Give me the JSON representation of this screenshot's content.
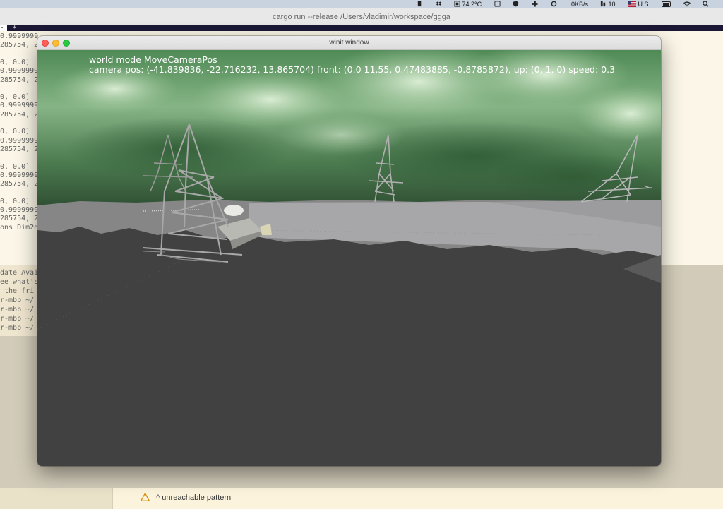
{
  "menubar": {
    "temperature": "74.2°C",
    "network": "0KB/s",
    "number": "10",
    "input_source": "U.S."
  },
  "terminal": {
    "title": "cargo run --release /Users/vladimir/workspace/ggga",
    "tab_label": "r",
    "tab_plus": "+",
    "lines": [
      "0.9999999",
      "285754, 2",
      "",
      "0, 0.0]",
      "0.9999999",
      "285754, 2",
      "",
      "0, 0.0]",
      "0.9999999",
      "285754, 2",
      "",
      "0, 0.0]",
      "0.9999999",
      "285754, 2",
      "",
      "0, 0.0]",
      "0.9999999",
      "285754, 2",
      "",
      "0, 0.0]",
      "0.9999999",
      "285754, 2",
      "ons Dim2d"
    ],
    "lower_lines": [
      "date Avai",
      "ee what's",
      " the fri",
      "r-mbp ~/",
      "r-mbp ~/",
      "r-mbp ~/",
      "r-mbp ~/"
    ]
  },
  "winit": {
    "title": "winit window",
    "hud_line1": "world mode MoveCameraPos",
    "hud_line2": "camera pos: (-41.839836, -22.716232, 13.865704) front: (0.0 11.55, 0.47483885, -0.8785872), up: (0, 1, 0) speed: 0.3"
  },
  "editor": {
    "warning": "unreachable pattern"
  },
  "colors": {
    "sky_green": "#5c9a5c",
    "ground_dark": "#414141",
    "plane_gray": "#a7a7a9"
  }
}
